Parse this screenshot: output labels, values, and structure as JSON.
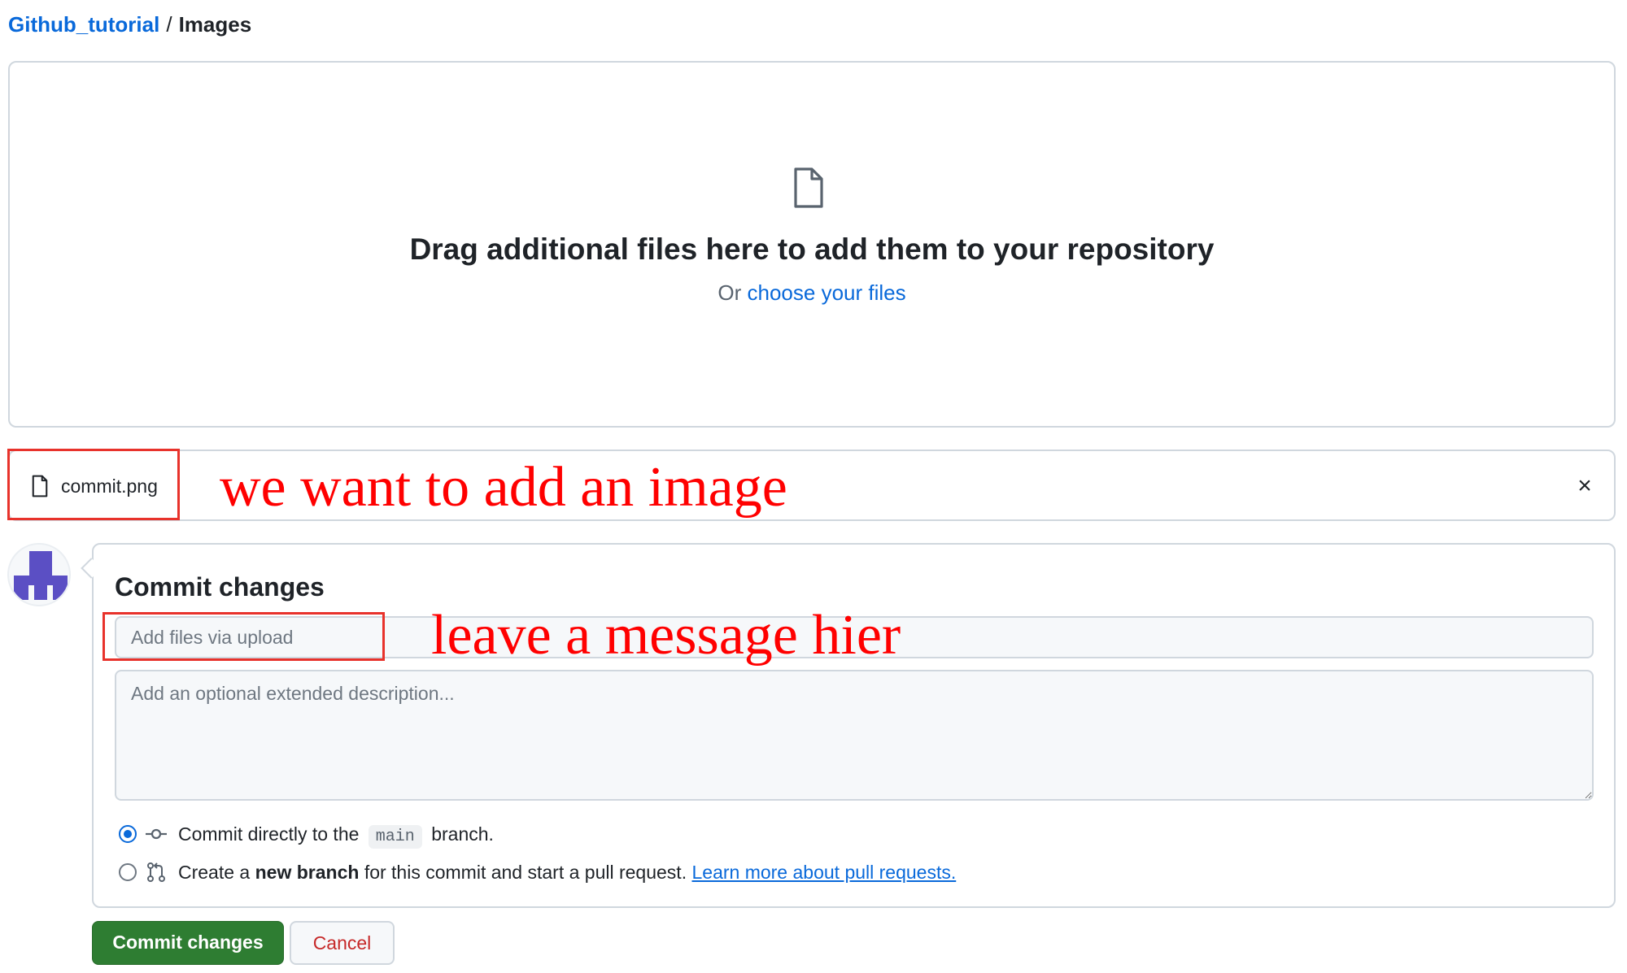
{
  "breadcrumb": {
    "repo": "Github_tutorial",
    "separator": "/",
    "current": "Images"
  },
  "dropzone": {
    "icon": "file-icon",
    "title": "Drag additional files here to add them to your repository",
    "prefix": "Or",
    "link": "choose your files"
  },
  "upload": {
    "file_name": "commit.png",
    "remove_icon": "close-icon",
    "remove_glyph": "×"
  },
  "annotations": {
    "file_note": "we want to add an image",
    "message_note": "leave a message hier",
    "color": "#ff0000"
  },
  "commit": {
    "title": "Commit changes",
    "message_placeholder": "Add files via upload",
    "description_placeholder": "Add an optional extended description...",
    "options": {
      "direct": {
        "selected": true,
        "before": "Commit directly to the",
        "branch": "main",
        "after": "branch."
      },
      "new_branch": {
        "selected": false,
        "before": "Create a",
        "bold": "new branch",
        "after": "for this commit and start a pull request.",
        "link": "Learn more about pull requests."
      }
    },
    "submit_label": "Commit changes",
    "cancel_label": "Cancel"
  },
  "colors": {
    "link": "#0969da",
    "primary_button": "#2e7d32",
    "cancel_text": "#c62828",
    "avatar": "#5b4fc4",
    "annotation_box": "#e8322b"
  }
}
